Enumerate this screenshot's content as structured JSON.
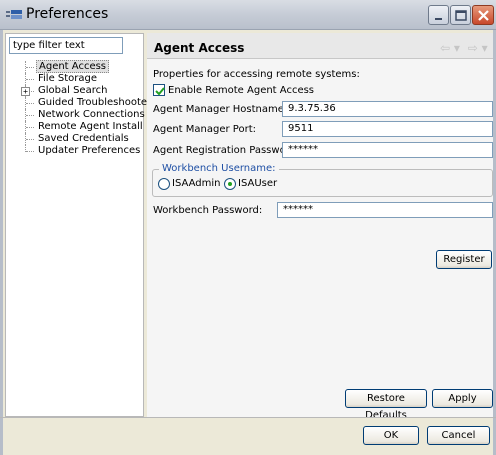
{
  "window": {
    "title": "Preferences"
  },
  "filter": {
    "placeholder": "type filter text",
    "value": "type filter text"
  },
  "tree": {
    "items": [
      {
        "label": "Agent Access",
        "selected": true,
        "expandable": false
      },
      {
        "label": "File Storage",
        "selected": false,
        "expandable": false
      },
      {
        "label": "Global Search",
        "selected": false,
        "expandable": true,
        "expander": "+"
      },
      {
        "label": "Guided Troubleshooter",
        "selected": false,
        "expandable": false
      },
      {
        "label": "Network Connections",
        "selected": false,
        "expandable": false
      },
      {
        "label": "Remote Agent Install",
        "selected": false,
        "expandable": false
      },
      {
        "label": "Saved Credentials",
        "selected": false,
        "expandable": false
      },
      {
        "label": "Updater Preferences",
        "selected": false,
        "expandable": false
      }
    ]
  },
  "page": {
    "title": "Agent Access",
    "nav_back": "⇦ ▾",
    "nav_forward": "⇨ ▾",
    "description": "Properties for accessing remote systems:",
    "enable_checkbox_label": "Enable Remote Agent Access",
    "enable_checked": true,
    "fields": {
      "hostname_label": "Agent Manager Hostname:",
      "hostname_value": "9.3.75.36",
      "port_label": "Agent Manager Port:",
      "port_value": "9511",
      "reg_password_label": "Agent Registration Password:",
      "reg_password_value": "******",
      "workbench_password_label": "Workbench Password:",
      "workbench_password_value": "******"
    },
    "workbench_group": {
      "legend": "Workbench Username:",
      "options": [
        {
          "label": "ISAAdmin",
          "checked": false
        },
        {
          "label": "ISAUser",
          "checked": true
        }
      ]
    },
    "register_button": "Register",
    "restore_defaults_button": "Restore Defaults",
    "apply_button": "Apply"
  },
  "footer": {
    "ok_button": "OK",
    "cancel_button": "Cancel"
  },
  "colors": {
    "group_legend": "#1e4fa4",
    "button_border": "#003c74",
    "close_button": "#c8482b"
  }
}
